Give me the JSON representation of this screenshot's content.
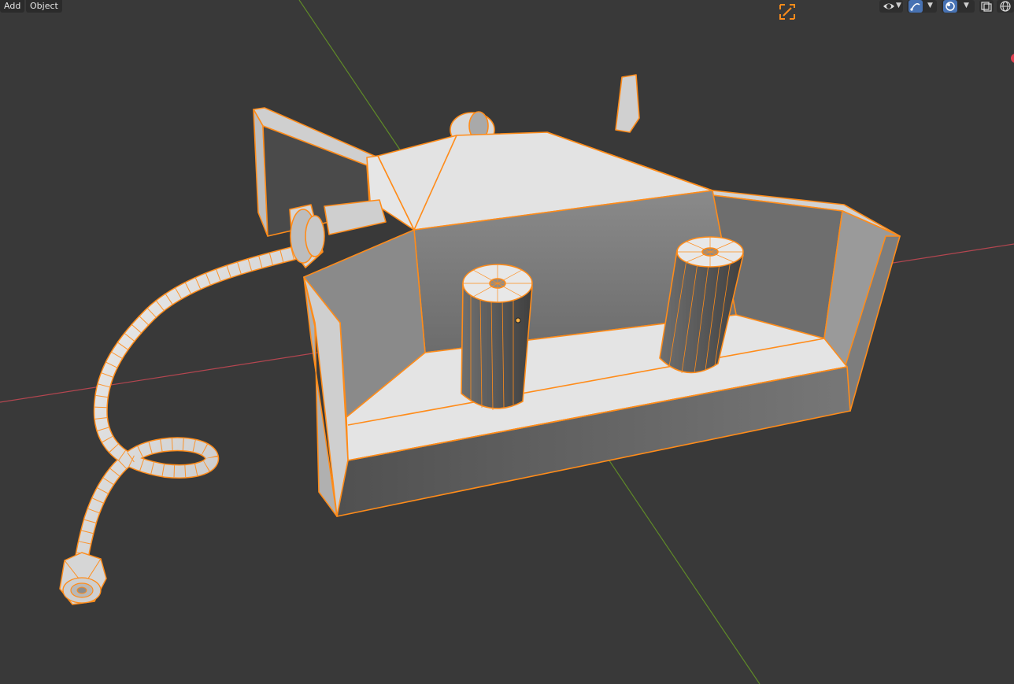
{
  "header": {
    "menus": {
      "add": "Add",
      "object": "Object"
    },
    "tools": {
      "selectability_icon": "eye-icon",
      "gizmo_icon": "gizmo-icon",
      "overlay_icon": "overlay-icon",
      "xray_icon": "xray-icon",
      "shading_icon": "wireframe-shading-icon"
    },
    "transform_pivot_icon": "snap-icon"
  },
  "colors": {
    "background": "#393939",
    "selection": "#ff8c1a",
    "mesh": "#d8d8d8",
    "x_axis": "#b44650",
    "y_axis": "#5f8a28",
    "accent_blue": "#4772b3"
  }
}
